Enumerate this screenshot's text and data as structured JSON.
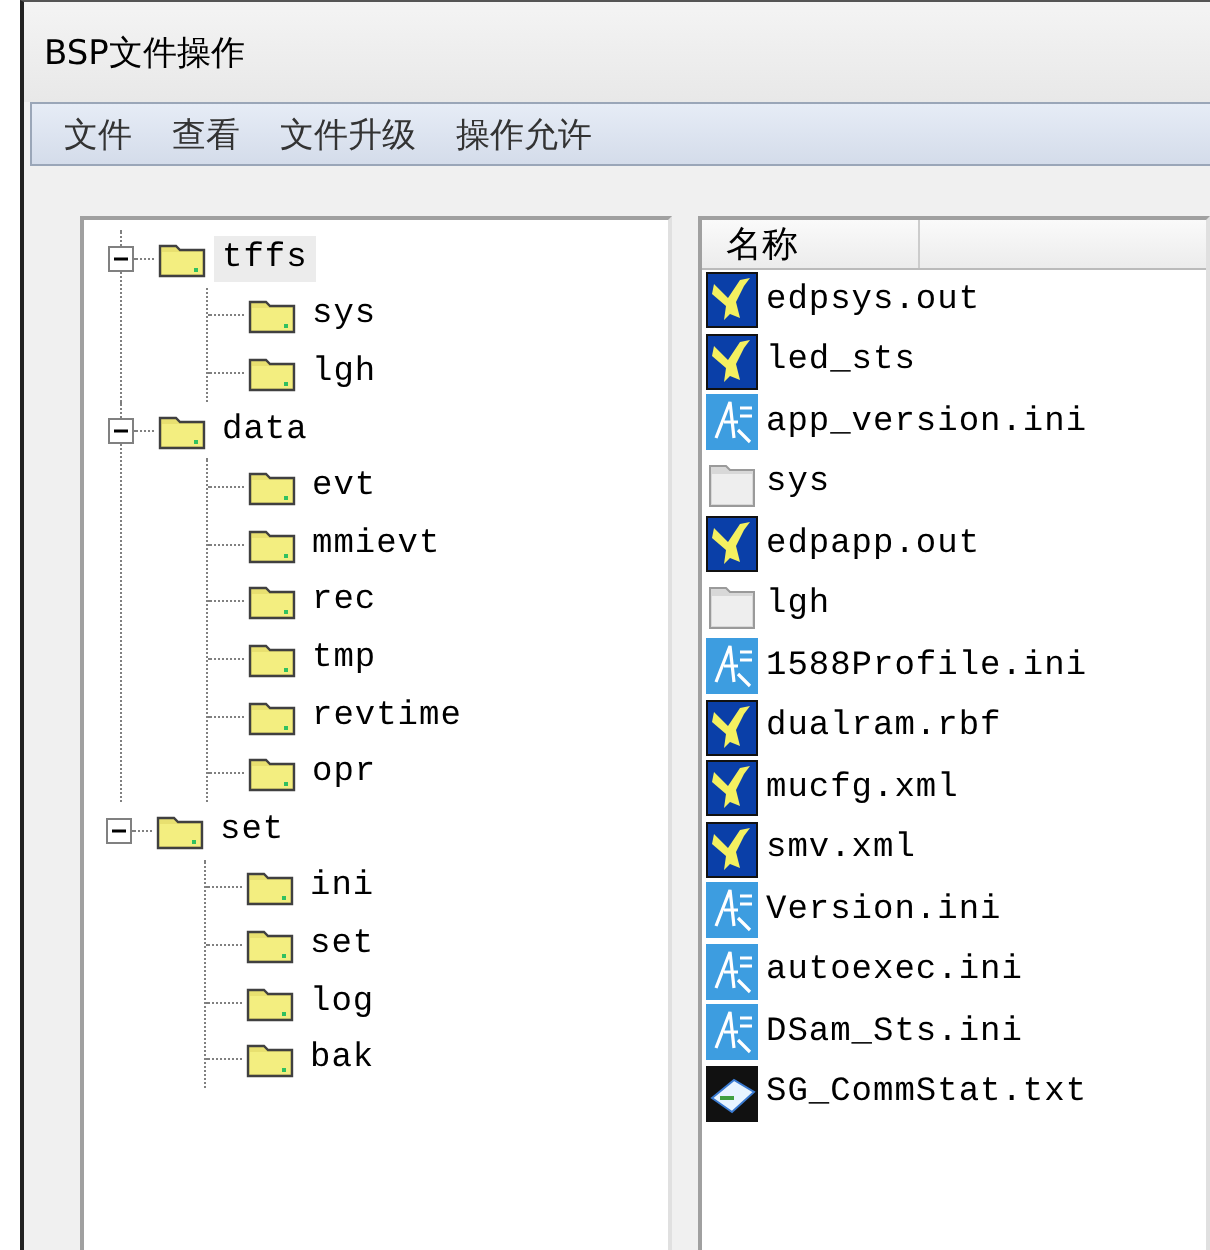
{
  "window": {
    "title": "BSP文件操作"
  },
  "menu": [
    "文件",
    "查看",
    "文件升级",
    "操作允许"
  ],
  "tree": [
    {
      "label": "tffs",
      "expanded": true,
      "selected": true,
      "children": [
        {
          "label": "sys",
          "selected": false
        },
        {
          "label": "lgh",
          "selected": false
        }
      ]
    },
    {
      "label": "data",
      "expanded": true,
      "selected": false,
      "children": [
        {
          "label": "evt",
          "selected": false
        },
        {
          "label": "mmievt",
          "selected": false
        },
        {
          "label": "rec",
          "selected": false
        },
        {
          "label": "tmp",
          "selected": false
        },
        {
          "label": "revtime",
          "selected": false
        },
        {
          "label": "opr",
          "selected": false
        }
      ]
    },
    {
      "label": "set",
      "expanded": true,
      "selected": false,
      "children": [
        {
          "label": "ini",
          "selected": false
        },
        {
          "label": "set",
          "selected": false
        },
        {
          "label": "log",
          "selected": false
        },
        {
          "label": "bak",
          "selected": false
        }
      ]
    }
  ],
  "list": {
    "columns": [
      "名称"
    ],
    "items": [
      {
        "name": "edpsys.out",
        "kind": "app"
      },
      {
        "name": "led_sts",
        "kind": "app"
      },
      {
        "name": "app_version.ini",
        "kind": "config"
      },
      {
        "name": "sys",
        "kind": "folder"
      },
      {
        "name": "edpapp.out",
        "kind": "app"
      },
      {
        "name": "lgh",
        "kind": "folder"
      },
      {
        "name": "1588Profile.ini",
        "kind": "config"
      },
      {
        "name": "dualram.rbf",
        "kind": "app"
      },
      {
        "name": "mucfg.xml",
        "kind": "app"
      },
      {
        "name": "smv.xml",
        "kind": "app"
      },
      {
        "name": "Version.ini",
        "kind": "config"
      },
      {
        "name": "autoexec.ini",
        "kind": "config"
      },
      {
        "name": "DSam_Sts.ini",
        "kind": "config"
      },
      {
        "name": "SG_CommStat.txt",
        "kind": "text"
      }
    ]
  }
}
